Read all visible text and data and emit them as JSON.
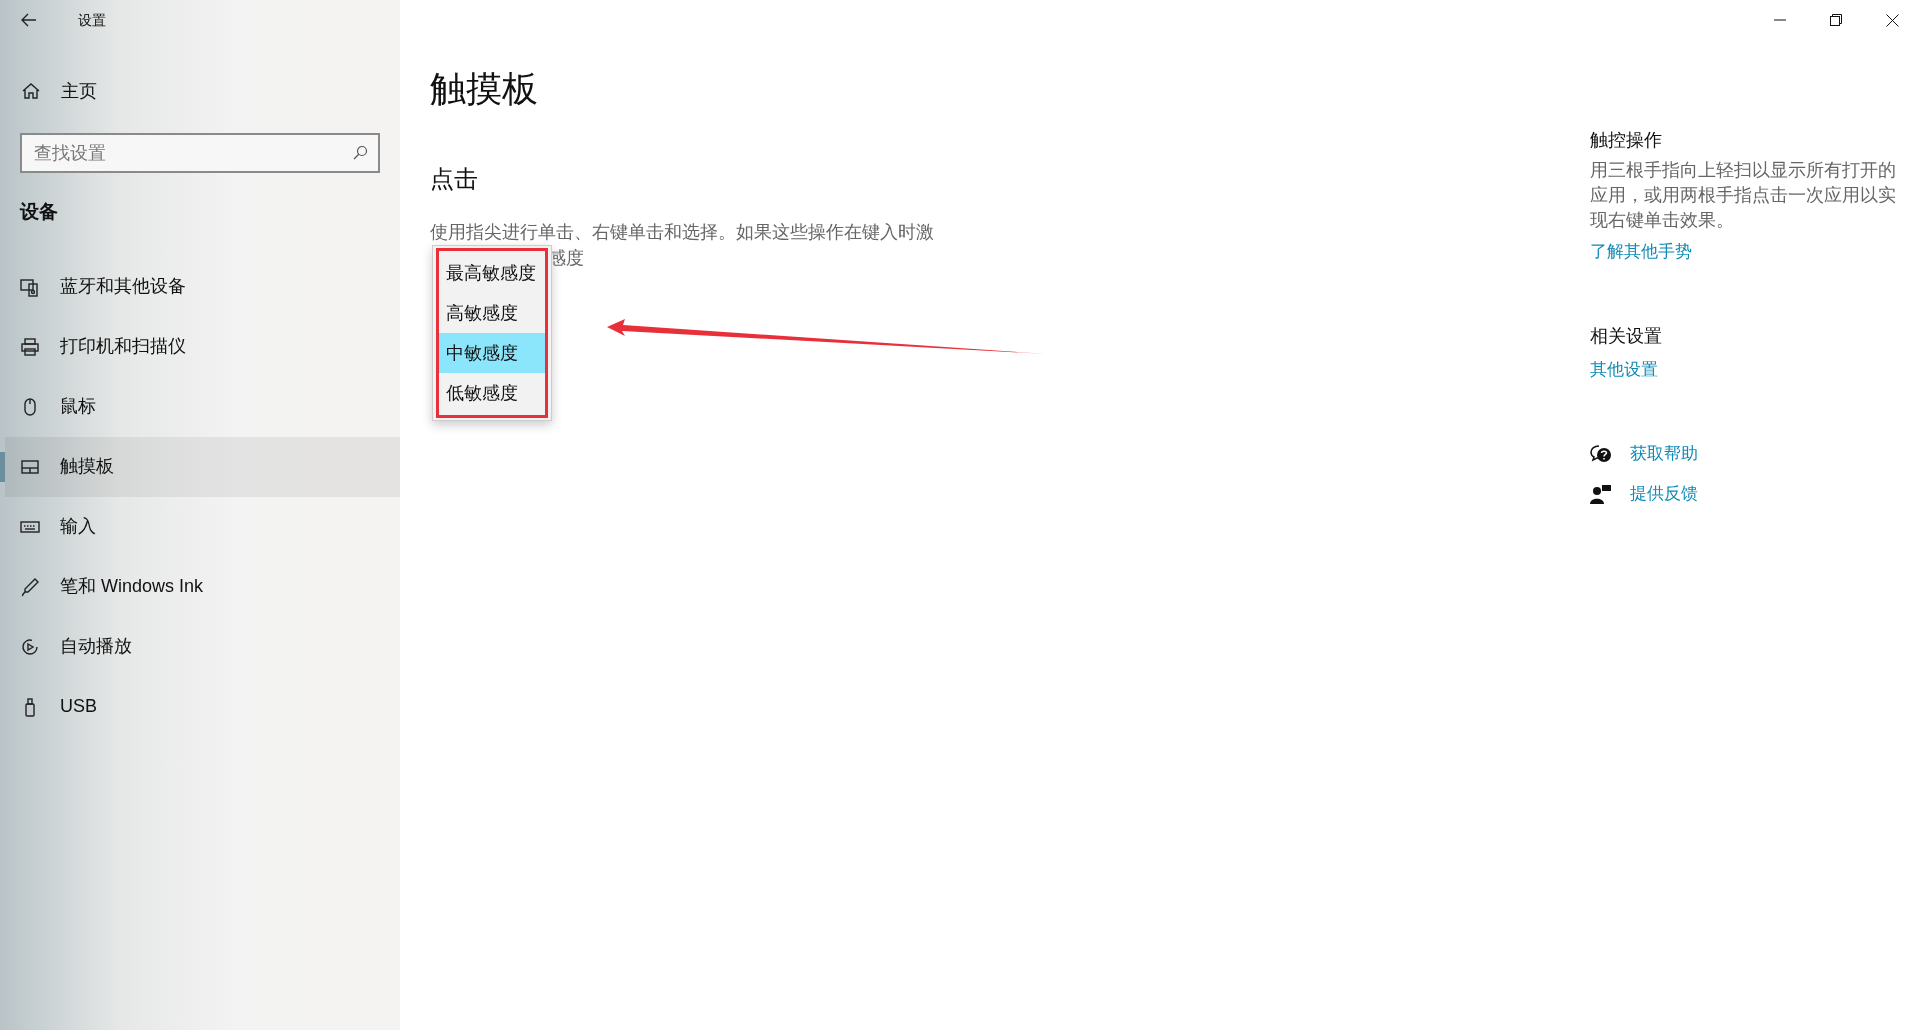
{
  "window": {
    "title": "设置"
  },
  "sidebar": {
    "home": "主页",
    "search": {
      "placeholder": "查找设置"
    },
    "section": "设备",
    "items": [
      {
        "label": "蓝牙和其他设备",
        "kind": "devices",
        "selected": false
      },
      {
        "label": "打印机和扫描仪",
        "kind": "printer",
        "selected": false
      },
      {
        "label": "鼠标",
        "kind": "mouse",
        "selected": false
      },
      {
        "label": "触摸板",
        "kind": "touchpad",
        "selected": true
      },
      {
        "label": "输入",
        "kind": "keyboard",
        "selected": false
      },
      {
        "label": "笔和 Windows Ink",
        "kind": "pen",
        "selected": false
      },
      {
        "label": "自动播放",
        "kind": "autoplay",
        "selected": false
      },
      {
        "label": "USB",
        "kind": "usb",
        "selected": false
      }
    ]
  },
  "main": {
    "title": "触摸板",
    "section": "点击",
    "description": "使用指尖进行单击、右键单击和选择。如果这些操作在键入时激",
    "description_tail": "感度",
    "dropdown": [
      {
        "label": "最高敏感度",
        "selected": false
      },
      {
        "label": "高敏感度",
        "selected": false
      },
      {
        "label": "中敏感度",
        "selected": true
      },
      {
        "label": "低敏感度",
        "selected": false
      }
    ]
  },
  "aside": {
    "gestures_title": "触控操作",
    "gestures_text": "用三根手指向上轻扫以显示所有打开的应用，或用两根手指点击一次应用以实现右键单击效果。",
    "gestures_link": "了解其他手势",
    "related_title": "相关设置",
    "related_link": "其他设置",
    "help": [
      {
        "label": "获取帮助",
        "kind": "help"
      },
      {
        "label": "提供反馈",
        "kind": "feedback"
      }
    ]
  }
}
